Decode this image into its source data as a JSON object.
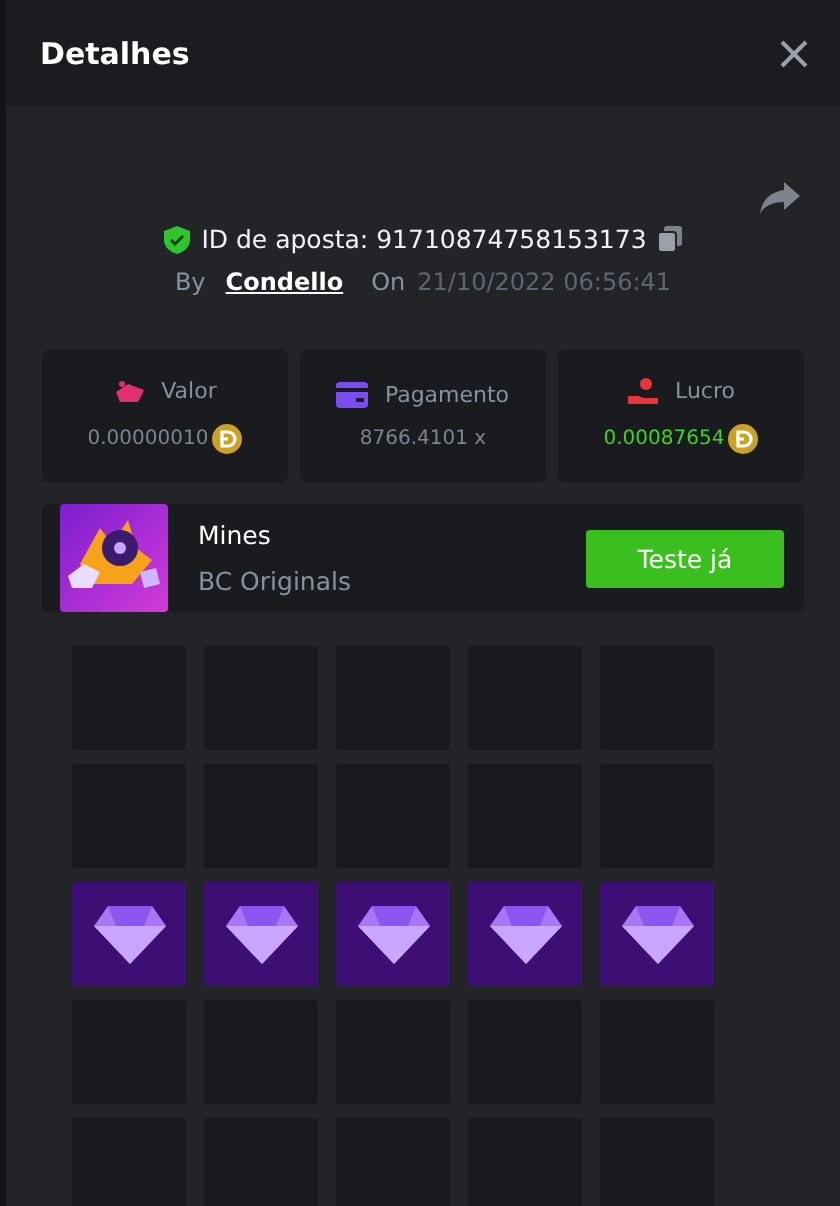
{
  "header": {
    "title": "Detalhes"
  },
  "bet": {
    "id_label": "ID de aposta:",
    "id": "91710874758153173",
    "by_label": "By",
    "user": "Condello",
    "on_label": "On",
    "date": "21/10/2022 06:56:41"
  },
  "stats": [
    {
      "kind": "amount",
      "label": "Valor",
      "value": "0.00000010",
      "coin": true,
      "positive": false
    },
    {
      "kind": "payout",
      "label": "Pagamento",
      "value": "8766.4101 x",
      "coin": false,
      "positive": false
    },
    {
      "kind": "profit",
      "label": "Lucro",
      "value": "0.00087654",
      "coin": true,
      "positive": true
    }
  ],
  "game": {
    "name": "Mines",
    "provider": "BC Originals",
    "button": "Teste já"
  },
  "grid": {
    "tiles": [
      {
        "kind": "hidden"
      },
      {
        "kind": "hidden"
      },
      {
        "kind": "hidden"
      },
      {
        "kind": "hidden"
      },
      {
        "kind": "hidden"
      },
      {
        "kind": "hidden"
      },
      {
        "kind": "hidden"
      },
      {
        "kind": "hidden"
      },
      {
        "kind": "hidden"
      },
      {
        "kind": "hidden"
      },
      {
        "kind": "gem"
      },
      {
        "kind": "gem"
      },
      {
        "kind": "gem"
      },
      {
        "kind": "gem"
      },
      {
        "kind": "gem"
      },
      {
        "kind": "hidden"
      },
      {
        "kind": "hidden"
      },
      {
        "kind": "hidden"
      },
      {
        "kind": "hidden"
      },
      {
        "kind": "hidden"
      },
      {
        "kind": "hidden"
      },
      {
        "kind": "hidden"
      },
      {
        "kind": "hidden"
      },
      {
        "kind": "hidden"
      },
      {
        "kind": "hidden"
      }
    ]
  }
}
